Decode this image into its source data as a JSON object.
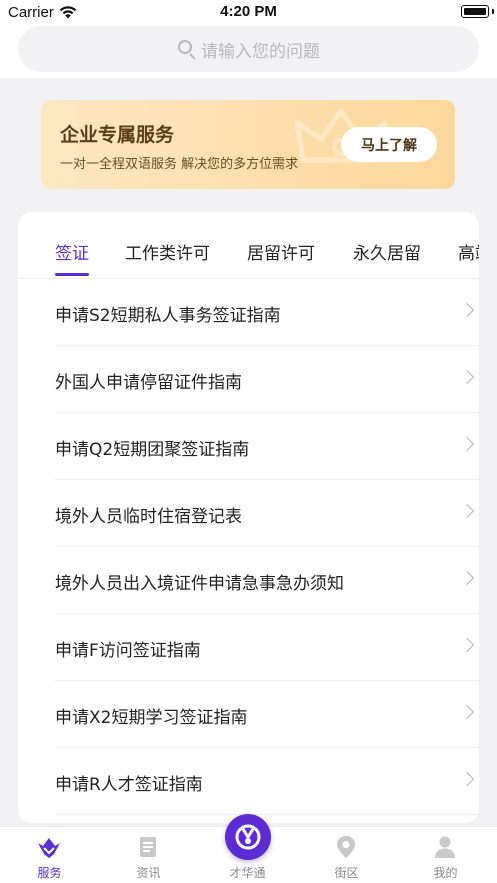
{
  "status_bar": {
    "carrier": "Carrier",
    "time": "4:20 PM"
  },
  "search": {
    "placeholder": "请输入您的问题"
  },
  "promo": {
    "title": "企业专属服务",
    "subtitle": "一对一全程双语服务 解决您的多方位需求",
    "button": "马上了解"
  },
  "tabs": [
    {
      "label": "签证",
      "active": true
    },
    {
      "label": "工作类许可",
      "active": false
    },
    {
      "label": "居留许可",
      "active": false
    },
    {
      "label": "永久居留",
      "active": false
    },
    {
      "label": "高端",
      "active": false
    }
  ],
  "list": [
    {
      "label": "申请S2短期私人事务签证指南"
    },
    {
      "label": "外国人申请停留证件指南"
    },
    {
      "label": "申请Q2短期团聚签证指南"
    },
    {
      "label": "境外人员临时住宿登记表"
    },
    {
      "label": "境外人员出入境证件申请急事急办须知"
    },
    {
      "label": "申请F访问签证指南"
    },
    {
      "label": "申请X2短期学习签证指南"
    },
    {
      "label": "申请R人才签证指南"
    }
  ],
  "bottom_nav": [
    {
      "label": "服务",
      "icon": "service-icon",
      "active": true
    },
    {
      "label": "资讯",
      "icon": "news-icon",
      "active": false
    },
    {
      "label": "才华通",
      "icon": "talent-icon",
      "active": false
    },
    {
      "label": "街区",
      "icon": "location-pin-icon",
      "active": false
    },
    {
      "label": "我的",
      "icon": "profile-icon",
      "active": false
    }
  ],
  "colors": {
    "accent": "#5b2bd6",
    "promo_start": "#fde8c3",
    "promo_end": "#fcd79a",
    "background": "#f2f2f4"
  }
}
